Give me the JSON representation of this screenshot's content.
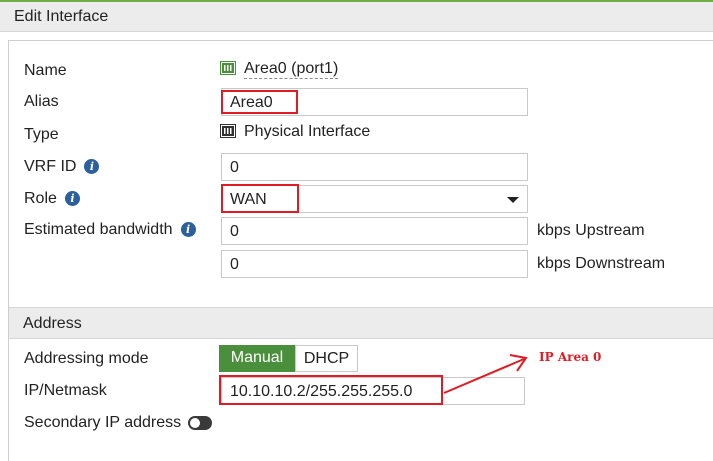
{
  "header": {
    "title": "Edit Interface"
  },
  "fields": {
    "name": {
      "label": "Name",
      "value": "Area0 (port1)"
    },
    "alias": {
      "label": "Alias",
      "value": "Area0"
    },
    "type": {
      "label": "Type",
      "value": "Physical Interface"
    },
    "vrf": {
      "label": "VRF ID",
      "value": "0"
    },
    "role": {
      "label": "Role",
      "value": "WAN"
    },
    "bandwidth": {
      "label": "Estimated bandwidth",
      "upstream_value": "0",
      "upstream_unit": "kbps Upstream",
      "downstream_value": "0",
      "downstream_unit": "kbps Downstream"
    }
  },
  "address": {
    "title": "Address",
    "mode_label": "Addressing mode",
    "modes": [
      "Manual",
      "DHCP"
    ],
    "selected_mode": "Manual",
    "ip_label": "IP/Netmask",
    "ip_value": "10.10.10.2/255.255.255.0",
    "secondary_label": "Secondary IP address",
    "secondary_enabled": false
  },
  "annotation": {
    "text": "IP Area 0",
    "color": "#e01b24"
  },
  "icons": {
    "info": "info-icon",
    "port": "port-icon",
    "dropdown": "chevron-down-icon",
    "toggle": "toggle-switch"
  },
  "colors": {
    "accent": "#4a8f3b",
    "highlight": "#e01b24",
    "info": "#2b5f9e"
  }
}
